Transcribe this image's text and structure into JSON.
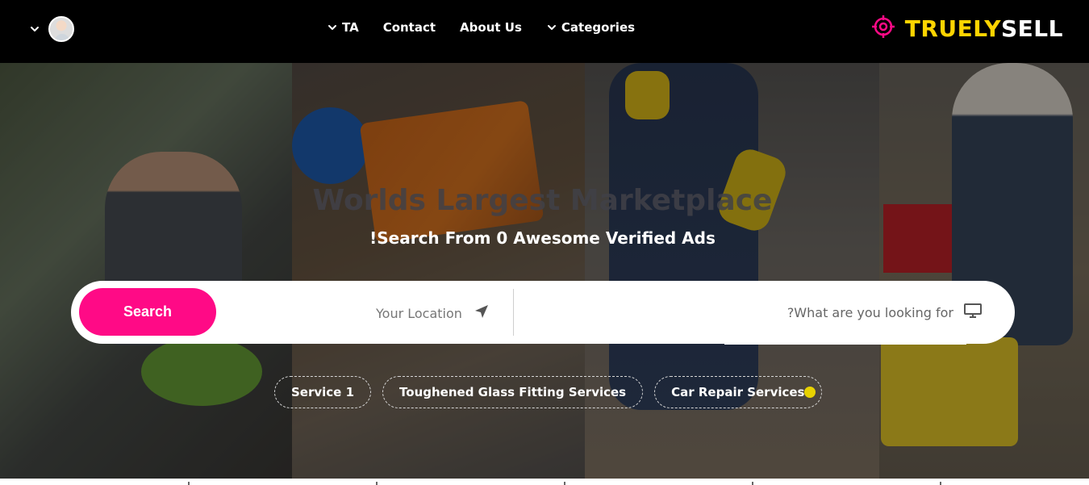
{
  "header": {
    "user_chevron_icon": "chevron-down-icon",
    "avatar_icon": "user-avatar",
    "nav": [
      {
        "label": "TA",
        "icon": "chevron-down-icon"
      },
      {
        "label": "Contact"
      },
      {
        "label": "About Us"
      },
      {
        "label": "Categories",
        "icon": "chevron-down-icon"
      }
    ],
    "brand": {
      "part1": "TRUELY",
      "part2": "SELL",
      "icon": "target-icon",
      "accent": "#ffd400",
      "icon_color": "#ff0a86"
    }
  },
  "hero": {
    "headline": "Worlds Largest Marketplace",
    "subline": "!Search From 0 Awesome Verified Ads",
    "search_button": "Search",
    "location_placeholder": "Your Location",
    "location_icon": "navigation-arrow-icon",
    "query_placeholder": "?What are you looking for",
    "query_icon": "monitor-icon",
    "chips": [
      "Service 1",
      "Toughened Glass Fitting Services",
      "Car Repair Services"
    ]
  }
}
